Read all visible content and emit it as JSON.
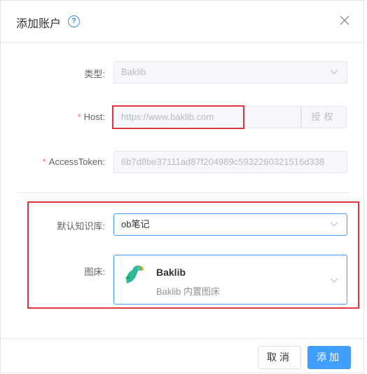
{
  "dialog": {
    "title": "添加账户",
    "help_icon": "?"
  },
  "form": {
    "type": {
      "label": "类型:",
      "value": "Baklib"
    },
    "host": {
      "required_mark": "*",
      "label": "Host:",
      "placeholder": "https://www.baklib.com",
      "auth_button": "授权"
    },
    "token": {
      "required_mark": "*",
      "label": "AccessToken:",
      "value": "6b7d8be37111ad87f204989c5932260321516d338"
    },
    "default_kb": {
      "label": "默认知识库:",
      "value": "ob笔记"
    },
    "image_bed": {
      "label": "图床:",
      "name": "Baklib",
      "description": "Baklib 内置图床"
    }
  },
  "footer": {
    "cancel_label": "取消",
    "add_label": "添加"
  },
  "colors": {
    "primary": "#409eff",
    "highlight_box": "#e0373e",
    "required": "#f56c6c",
    "parrot": "#2fb99a"
  }
}
